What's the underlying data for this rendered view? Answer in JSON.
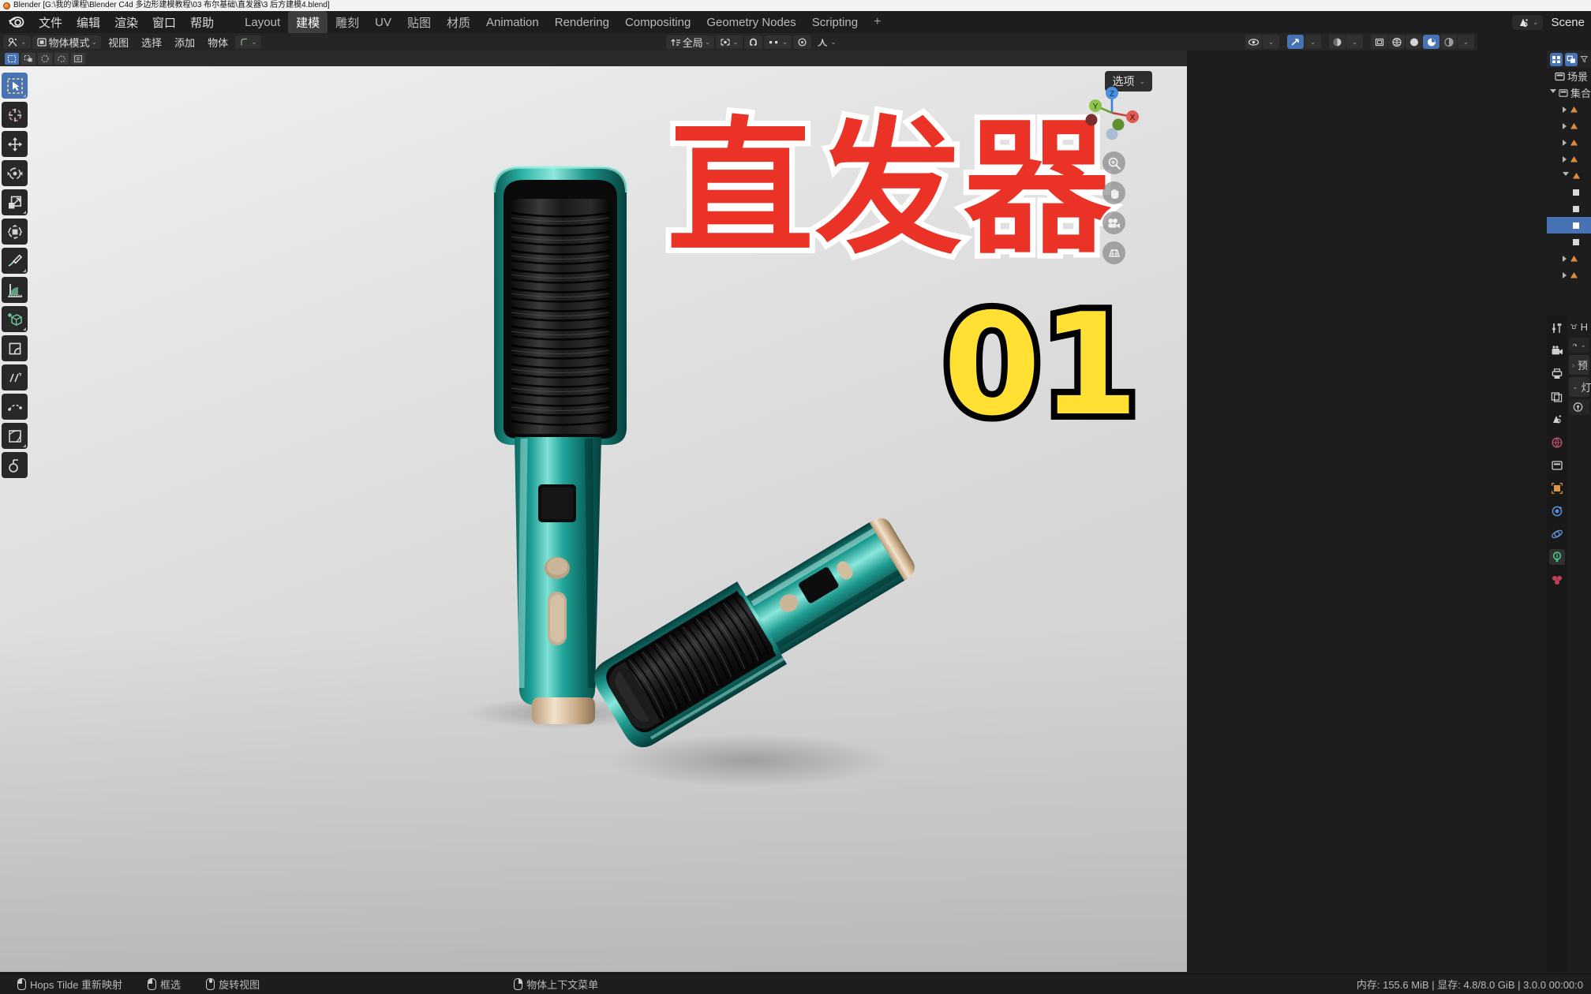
{
  "window": {
    "title": "Blender [G:\\我的课程\\Blender C4d 多边形建模教程\\03 布尔基础\\直发器\\3 后方建模4.blend]",
    "app_icon": "blender-logo-icon"
  },
  "topbar": {
    "menus": [
      "文件",
      "编辑",
      "渲染",
      "窗口",
      "帮助"
    ],
    "workspaces": [
      {
        "label": "Layout",
        "active": false
      },
      {
        "label": "建模",
        "active": true
      },
      {
        "label": "雕刻",
        "active": false
      },
      {
        "label": "UV",
        "active": false
      },
      {
        "label": "贴图",
        "active": false
      },
      {
        "label": "材质",
        "active": false
      },
      {
        "label": "Animation",
        "active": false
      },
      {
        "label": "Rendering",
        "active": false
      },
      {
        "label": "Compositing",
        "active": false
      },
      {
        "label": "Geometry Nodes",
        "active": false
      },
      {
        "label": "Scripting",
        "active": false
      }
    ],
    "add_workspace": "+",
    "scene_icon": "scene-icon",
    "scene_name": "Scene"
  },
  "viewport_header": {
    "editor_type_icon": "editor-type-icon",
    "mode": "物体模式",
    "mode_icon": "object-mode-icon",
    "menus": [
      "视图",
      "选择",
      "添加",
      "物体"
    ],
    "snap_mode_icon": "snap-icon",
    "transform_orientation": "全局",
    "pivot_icon": "pivot-point-icon",
    "snap_magnet_icon": "magnet-icon",
    "proportional_icon": "proportional-edit-icon",
    "falloff_icon": "falloff-curve-icon",
    "right_icons": [
      "visibility-eye-icon",
      "selectability-arrow-icon",
      "overlays-icon",
      "xray-icon",
      "shading-wireframe-icon",
      "shading-solid-icon",
      "shading-material-icon",
      "shading-rendered-icon",
      "shading-dropdown-icon"
    ]
  },
  "tool_settings": {
    "select_modes": [
      "select-box-icon",
      "select-tweak-icon",
      "select-circle-icon",
      "select-lasso-icon"
    ],
    "mode_options_icon": "mode-options-icon"
  },
  "toolbar": {
    "tools": [
      {
        "name": "tweak-select-box",
        "icon": "select-box-icon",
        "active": true
      },
      {
        "name": "cursor",
        "icon": "3d-cursor-icon",
        "active": false
      },
      {
        "name": "move",
        "icon": "move-icon",
        "active": false
      },
      {
        "name": "rotate",
        "icon": "rotate-icon",
        "active": false
      },
      {
        "name": "scale",
        "icon": "scale-icon",
        "active": false
      },
      {
        "name": "transform",
        "icon": "transform-icon",
        "active": false
      },
      {
        "name": "annotate",
        "icon": "annotate-pencil-icon",
        "active": false
      },
      {
        "name": "measure",
        "icon": "measure-ruler-icon",
        "active": false
      },
      {
        "name": "add-cube",
        "icon": "add-cube-icon",
        "active": false
      },
      {
        "name": "bevel",
        "icon": "bevel-icon",
        "active": false
      },
      {
        "name": "shear",
        "icon": "shear-icon",
        "active": false
      },
      {
        "name": "spin",
        "icon": "spin-icon",
        "active": false
      },
      {
        "name": "to-sphere",
        "icon": "to-sphere-icon",
        "active": false
      }
    ]
  },
  "viewport": {
    "options_label": "选项",
    "options_chevron": "chevron-down-icon",
    "gizmo_axes": [
      "Z",
      "Y",
      "X"
    ],
    "nav_buttons": [
      "zoom-icon",
      "pan-hand-icon",
      "camera-icon",
      "orthographic-grid-icon"
    ],
    "overlay_title": "直发器",
    "overlay_number": "01",
    "overlay_title_color": "#ea3326",
    "overlay_title_stroke": "#ffffff",
    "overlay_number_color": "#ffe033",
    "overlay_number_stroke": "#000000",
    "scene_description": "Two teal hair straightener brush models on a light grey studio backdrop"
  },
  "outliner": {
    "header_icons": [
      "editor-type-icon",
      "display-mode-icon",
      "filter-icon"
    ],
    "scene_collection": "场景",
    "rows": [
      {
        "label": "集合",
        "icon": "collection-icon",
        "expanded": true,
        "selected": false,
        "indent": 0
      },
      {
        "label": "",
        "icon": "mesh-object-icon",
        "expanded": false,
        "selected": false,
        "indent": 1
      },
      {
        "label": "",
        "icon": "mesh-object-icon",
        "expanded": false,
        "selected": false,
        "indent": 1
      },
      {
        "label": "",
        "icon": "mesh-object-icon",
        "expanded": false,
        "selected": false,
        "indent": 1
      },
      {
        "label": "",
        "icon": "mesh-object-icon",
        "expanded": false,
        "selected": false,
        "indent": 1
      },
      {
        "label": "",
        "icon": "mesh-object-icon",
        "expanded": true,
        "selected": false,
        "indent": 1
      },
      {
        "label": "",
        "icon": "modifier-icon",
        "expanded": false,
        "selected": false,
        "indent": 2
      },
      {
        "label": "",
        "icon": "modifier-icon",
        "expanded": false,
        "selected": false,
        "indent": 2
      },
      {
        "label": "",
        "icon": "modifier-icon",
        "expanded": false,
        "selected": true,
        "indent": 2
      },
      {
        "label": "",
        "icon": "modifier-icon",
        "expanded": false,
        "selected": false,
        "indent": 2
      },
      {
        "label": "",
        "icon": "mesh-object-icon",
        "expanded": false,
        "selected": false,
        "indent": 1
      },
      {
        "label": "",
        "icon": "mesh-object-icon",
        "expanded": false,
        "selected": false,
        "indent": 1
      }
    ],
    "filter_icon": "filter-dropdown-icon"
  },
  "properties": {
    "tabs": [
      {
        "name": "tool",
        "icon": "tool-icon",
        "active": false
      },
      {
        "name": "render",
        "icon": "render-camera-icon",
        "active": false
      },
      {
        "name": "output",
        "icon": "output-printer-icon",
        "active": false
      },
      {
        "name": "view-layer",
        "icon": "view-layer-images-icon",
        "active": false
      },
      {
        "name": "scene",
        "icon": "scene-cone-icon",
        "active": false
      },
      {
        "name": "world",
        "icon": "world-globe-icon",
        "active": false
      },
      {
        "name": "collection",
        "icon": "collection-box-icon",
        "active": false
      },
      {
        "name": "object",
        "icon": "object-square-icon",
        "active": false
      },
      {
        "name": "modifiers",
        "icon": "modifier-wrench-icon",
        "active": false
      },
      {
        "name": "physics",
        "icon": "physics-orbit-icon",
        "active": false
      },
      {
        "name": "object-data",
        "icon": "light-data-icon",
        "active": true
      },
      {
        "name": "material",
        "icon": "material-sphere-icon",
        "active": false
      }
    ],
    "breadcrumb_icon": "object-breadcrumb-icon",
    "breadcrumb_label": "H",
    "datablock_icon": "light-datablock-icon",
    "panels": [
      {
        "label": "预",
        "expanded": false,
        "chevron": "chevron-right-icon"
      },
      {
        "label": "灯",
        "expanded": true,
        "chevron": "chevron-down-icon"
      }
    ],
    "light_type_icon": "point-light-icon"
  },
  "statusbar": {
    "hints": [
      {
        "mouse": "left",
        "label": "Hops Tilde 重新映射"
      },
      {
        "mouse": "left-drag",
        "label": "框选"
      },
      {
        "mouse": "middle",
        "label": "旋转视图"
      },
      {
        "mouse": "right",
        "label": "物体上下文菜单"
      }
    ],
    "stats": "内存: 155.6 MiB | 显存: 4.8/8.0 GiB | 3.0.0  00:00:0"
  }
}
